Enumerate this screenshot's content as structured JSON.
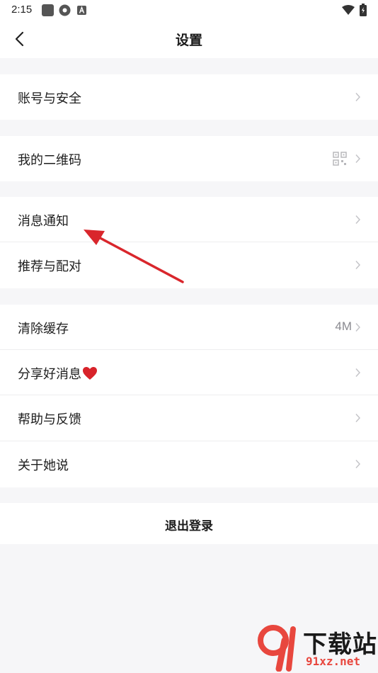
{
  "status_bar": {
    "time": "2:15"
  },
  "header": {
    "title": "设置"
  },
  "settings": [
    {
      "label": "账号与安全"
    },
    {
      "label": "我的二维码"
    },
    {
      "label": "消息通知"
    },
    {
      "label": "推荐与配对"
    },
    {
      "label": "清除缓存",
      "value": "4M"
    },
    {
      "label": "分享好消息"
    },
    {
      "label": "帮助与反馈"
    },
    {
      "label": "关于她说"
    }
  ],
  "logout": {
    "label": "退出登录"
  },
  "watermark": {
    "brand": "下载站",
    "site": "91xz.net"
  },
  "colors": {
    "background": "#f6f6f8",
    "card": "#ffffff",
    "annotation": "#d9262c",
    "heart": "#d8232a"
  },
  "icons": [
    "back-arrow-icon",
    "chevron-right-icon",
    "qr-code-icon",
    "heart-icon",
    "wifi-icon",
    "battery-icon"
  ]
}
